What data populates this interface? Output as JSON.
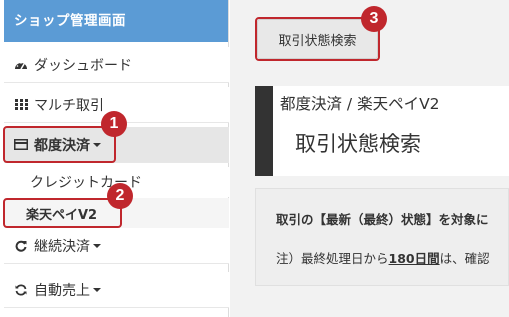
{
  "sidebar": {
    "title": "ショップ管理画面",
    "items": [
      {
        "label": "ダッシュボード",
        "icon": "dashboard-icon"
      },
      {
        "label": "マルチ取引",
        "icon": "grid-icon"
      },
      {
        "label": "都度決済",
        "icon": "credit-card-icon"
      },
      {
        "label": "継続決済",
        "icon": "refresh-icon"
      },
      {
        "label": "自動売上",
        "icon": "sync-icon"
      }
    ],
    "sub_items": [
      {
        "label": "クレジットカード"
      },
      {
        "label": "楽天ペイV2"
      }
    ]
  },
  "main": {
    "breadcrumb": "取引状態検索",
    "subtitle": "都度決済 / 楽天ペイV2",
    "title": "取引状態検索",
    "info": {
      "line1": "取引の【最新（最終）状態】を対象に",
      "line2_prefix": "注）最終処理日から",
      "line2_highlight": "180日間",
      "line2_suffix": "は、確認"
    }
  },
  "annotations": {
    "badge_1": "1",
    "badge_2": "2",
    "badge_3": "3",
    "highlight_color": "#c0272d"
  },
  "colors": {
    "header_bg": "#5b9bd5",
    "active_bg": "#e6e6e6",
    "main_bg": "#f2f2f2"
  }
}
